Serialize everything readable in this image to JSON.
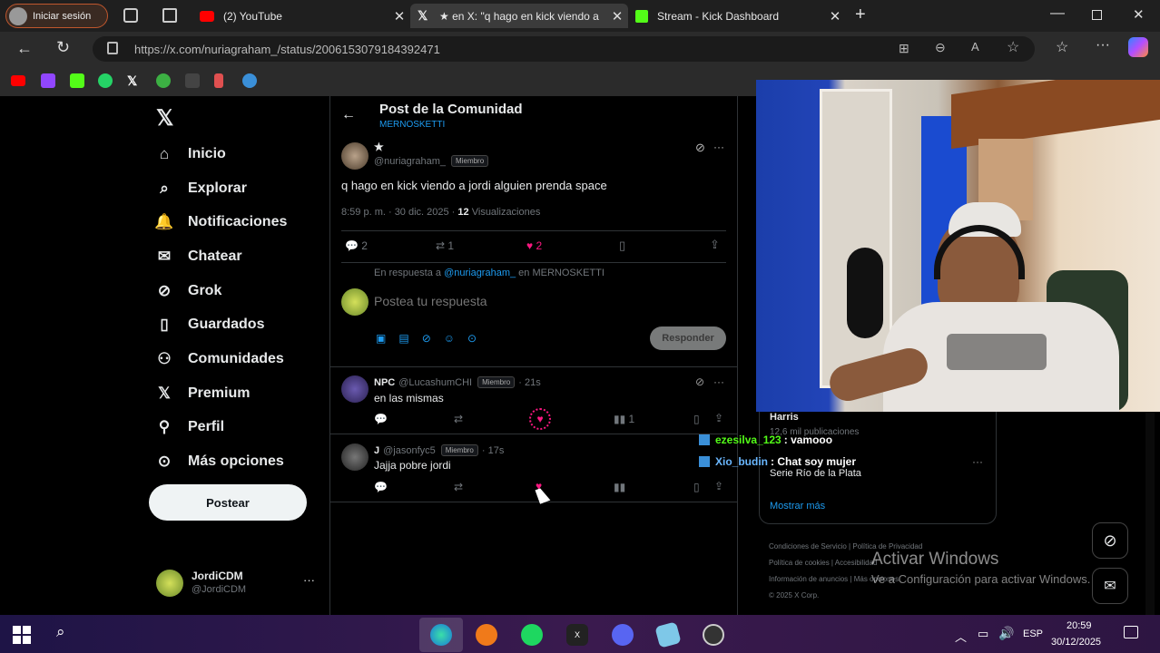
{
  "browser": {
    "profile_label": "Iniciar sesión",
    "tabs": [
      {
        "label": "(2) YouTube"
      },
      {
        "label": "★ en X: \"q hago en kick viendo a"
      },
      {
        "label": "Stream - Kick Dashboard"
      }
    ],
    "url": "https://x.com/nuriagraham_/status/2006153079184392471"
  },
  "x": {
    "nav": [
      {
        "label": "Inicio",
        "icon": "home-icon"
      },
      {
        "label": "Explorar",
        "icon": "search-icon"
      },
      {
        "label": "Notificaciones",
        "icon": "bell-icon"
      },
      {
        "label": "Chatear",
        "icon": "mail-icon"
      },
      {
        "label": "Grok",
        "icon": "grok-icon"
      },
      {
        "label": "Guardados",
        "icon": "bookmark-icon"
      },
      {
        "label": "Comunidades",
        "icon": "people-icon"
      },
      {
        "label": "Premium",
        "icon": "x-icon"
      },
      {
        "label": "Perfil",
        "icon": "person-icon"
      },
      {
        "label": "Más opciones",
        "icon": "more-icon"
      }
    ],
    "post_button": "Postear",
    "account": {
      "name": "JordiCDM",
      "handle": "@JordiCDM"
    },
    "header": {
      "title": "Post de la Comunidad",
      "community": "MERNOSKETTI"
    },
    "post": {
      "name": "★",
      "handle": "@nuriagraham_",
      "badge": "Miembro",
      "text": "q hago en kick viendo a jordi alguien prenda space",
      "time": "8:59 p. m. · 30 dic. 2025 ·",
      "views_count": "12",
      "views_label": "Visualizaciones",
      "replies": "2",
      "reposts": "1",
      "likes": "2"
    },
    "reply_context": {
      "prefix": "En respuesta a",
      "mention": "@nuriagraham_",
      "suffix": "en MERNOSKETTI"
    },
    "composer": {
      "placeholder": "Postea tu respuesta",
      "button": "Responder"
    },
    "replies": [
      {
        "name": "NPC",
        "handle": "@LucashumCHI",
        "badge": "Miembro",
        "time": "· 21s",
        "text": "en las mismas",
        "views": "1"
      },
      {
        "name": "J",
        "handle": "@jasonfyc5",
        "badge": "Miembro",
        "time": "· 17s",
        "text": "Jajja pobre jordi"
      }
    ],
    "sidebar": {
      "name": "Harris",
      "stats": "12,6 mil publicaciones",
      "location": "Serie Río de la Plata",
      "show_more": "Mostrar más"
    },
    "footer": [
      "Condiciones de Servicio",
      "Política de Privacidad",
      "Política de cookies",
      "Accesibilidad",
      "Información de anuncios",
      "Más opciones",
      "© 2025 X Corp."
    ]
  },
  "chat": [
    {
      "user": "ezesilva_123",
      "msg": ": vamooo",
      "color": "#53fc18"
    },
    {
      "user": "Xio_budin",
      "msg": ": Chat soy mujer",
      "color": "#6ab7ff"
    }
  ],
  "watermark": {
    "title": "Activar Windows",
    "subtitle": "Ve a Configuración para activar Windows."
  },
  "taskbar": {
    "lang": "ESP",
    "time": "20:59",
    "date": "30/12/2025"
  },
  "colors": {
    "x_blue": "#1d9bf0",
    "like_pink": "#f91880",
    "kick_green": "#53fc18"
  }
}
